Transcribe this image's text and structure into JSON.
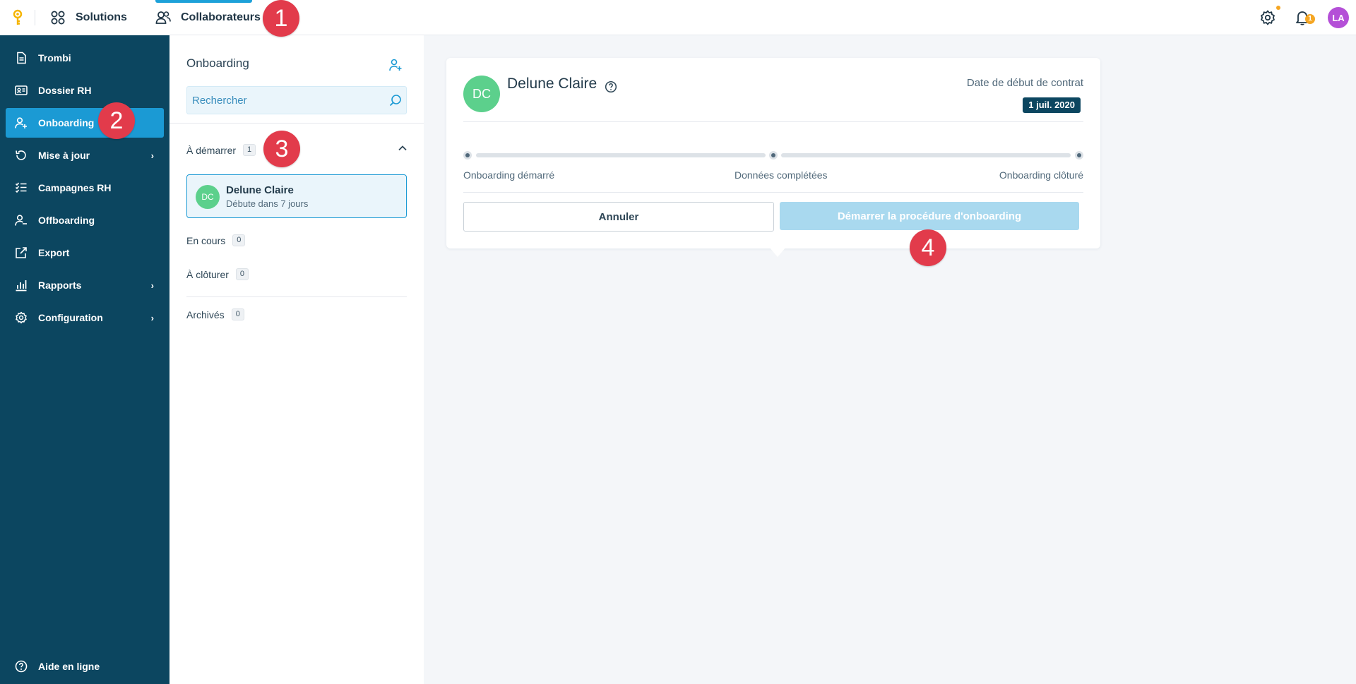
{
  "topbar": {
    "solutions_label": "Solutions",
    "collaborateurs_label": "Collaborateurs",
    "notifications_count": "1",
    "user_initials": "LA"
  },
  "sidebar": {
    "items": [
      {
        "label": "Trombi",
        "icon": "document-icon"
      },
      {
        "label": "Dossier RH",
        "icon": "id-card-icon"
      },
      {
        "label": "Onboarding",
        "icon": "user-plus-icon",
        "active": true
      },
      {
        "label": "Mise à jour",
        "icon": "refresh-icon",
        "chevron": "›"
      },
      {
        "label": "Campagnes RH",
        "icon": "checklist-icon"
      },
      {
        "label": "Offboarding",
        "icon": "user-minus-icon"
      },
      {
        "label": "Export",
        "icon": "external-link-icon"
      },
      {
        "label": "Rapports",
        "icon": "bar-chart-icon",
        "chevron": "›"
      },
      {
        "label": "Configuration",
        "icon": "gear-icon",
        "chevron": "›"
      }
    ],
    "help_label": "Aide en ligne"
  },
  "onboarding_panel": {
    "title": "Onboarding",
    "search_placeholder": "Rechercher",
    "groups": [
      {
        "label": "À démarrer",
        "count": "1"
      },
      {
        "label": "En cours",
        "count": "0"
      },
      {
        "label": "À clôturer",
        "count": "0"
      },
      {
        "label": "Archivés",
        "count": "0"
      }
    ],
    "person": {
      "initials": "DC",
      "name": "Delune Claire",
      "subtitle": "Débute dans 7 jours"
    }
  },
  "detail": {
    "initials": "DC",
    "name": "Delune Claire",
    "date_label": "Date de début de contrat",
    "date_value": "1 juil. 2020",
    "steps": [
      "Onboarding démarré",
      "Données complétées",
      "Onboarding clôturé"
    ],
    "cancel_label": "Annuler",
    "start_label": "Démarrer la procédure d'onboarding"
  },
  "markers": [
    "1",
    "2",
    "3",
    "4"
  ],
  "colors": {
    "sidebar_bg": "#0c4660",
    "accent": "#1b9ad4",
    "avatar_green": "#5cd08c",
    "marker_red": "#e23b4b",
    "badge_orange": "#f5a623",
    "user_avatar": "#b44fd7"
  }
}
